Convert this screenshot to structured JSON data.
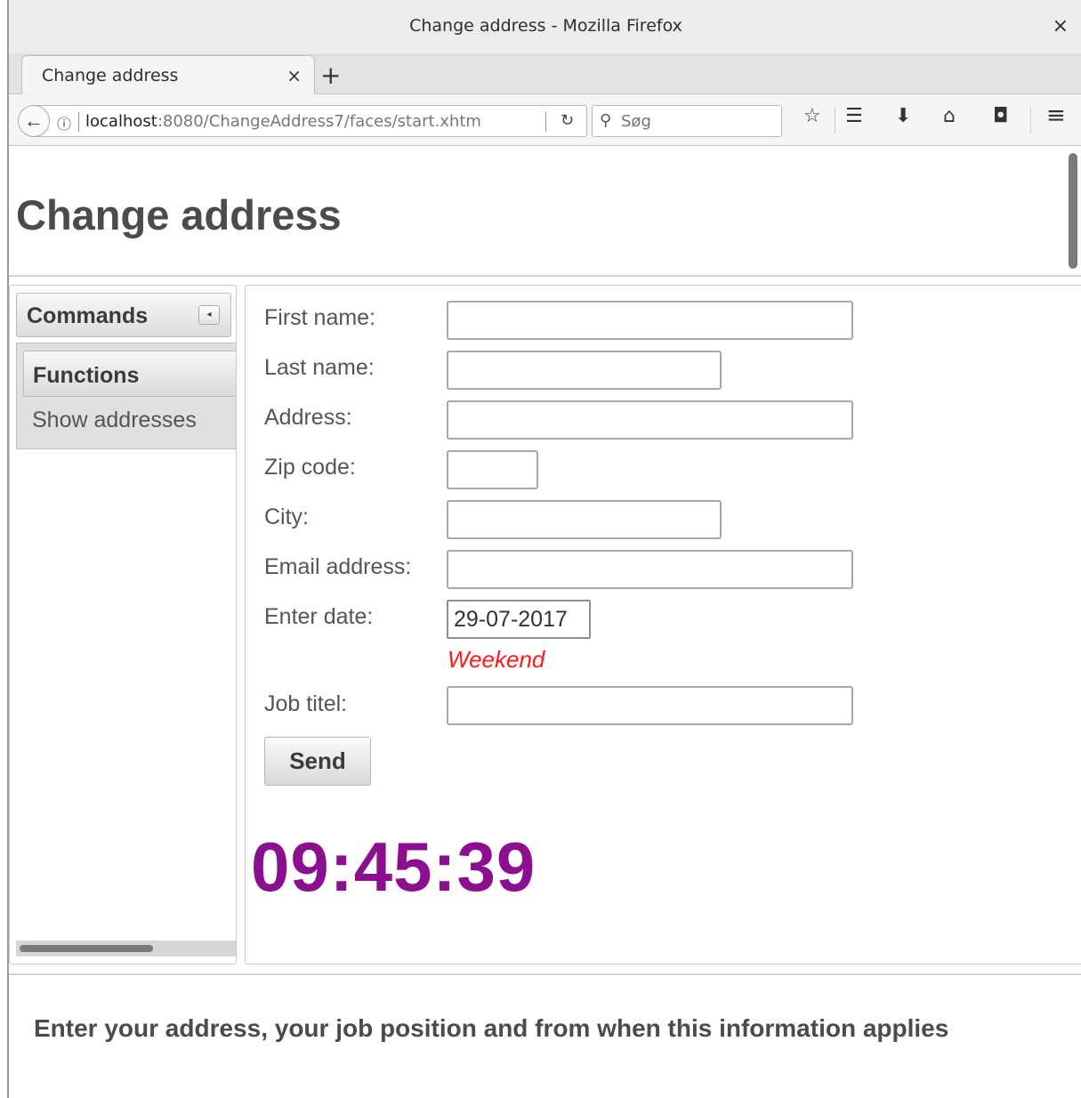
{
  "window": {
    "title": "Change address - Mozilla Firefox",
    "close": "×"
  },
  "tabs": [
    {
      "label": "Change address",
      "close": "×"
    }
  ],
  "new_tab": "+",
  "navbar": {
    "back": "←",
    "info": "ⓘ",
    "url_host": "localhost",
    "url_rest": ":8080/ChangeAddress7/faces/start.xhtm",
    "reload": "↻",
    "search_icon": "⚲",
    "search_placeholder": "Søg",
    "icons": {
      "bookmark_star": "☆",
      "reading_list": "☰",
      "downloads": "⬇",
      "home": "⌂",
      "pocket": "◘",
      "menu": "≡"
    }
  },
  "page": {
    "title": "Change address",
    "sidebar": {
      "header": "Commands",
      "collapse_icon": "◂",
      "section": "Functions",
      "items": [
        "Show addresses"
      ]
    },
    "form": {
      "first_name_label": "First name:",
      "first_name_value": "",
      "last_name_label": "Last name:",
      "last_name_value": "",
      "address_label": "Address:",
      "address_value": "",
      "zip_label": "Zip code:",
      "zip_value": "",
      "city_label": "City:",
      "city_value": "",
      "email_label": "Email address:",
      "email_value": "",
      "date_label": "Enter date:",
      "date_value": "29-07-2017",
      "date_message": "Weekend",
      "job_label": "Job titel:",
      "job_value": "",
      "send_label": "Send"
    },
    "clock": "09:45:39",
    "footer_text": "Enter your address, your job position and from when this information applies"
  },
  "colors": {
    "clock": "#8c0f91",
    "error": "#ff1a1a"
  }
}
